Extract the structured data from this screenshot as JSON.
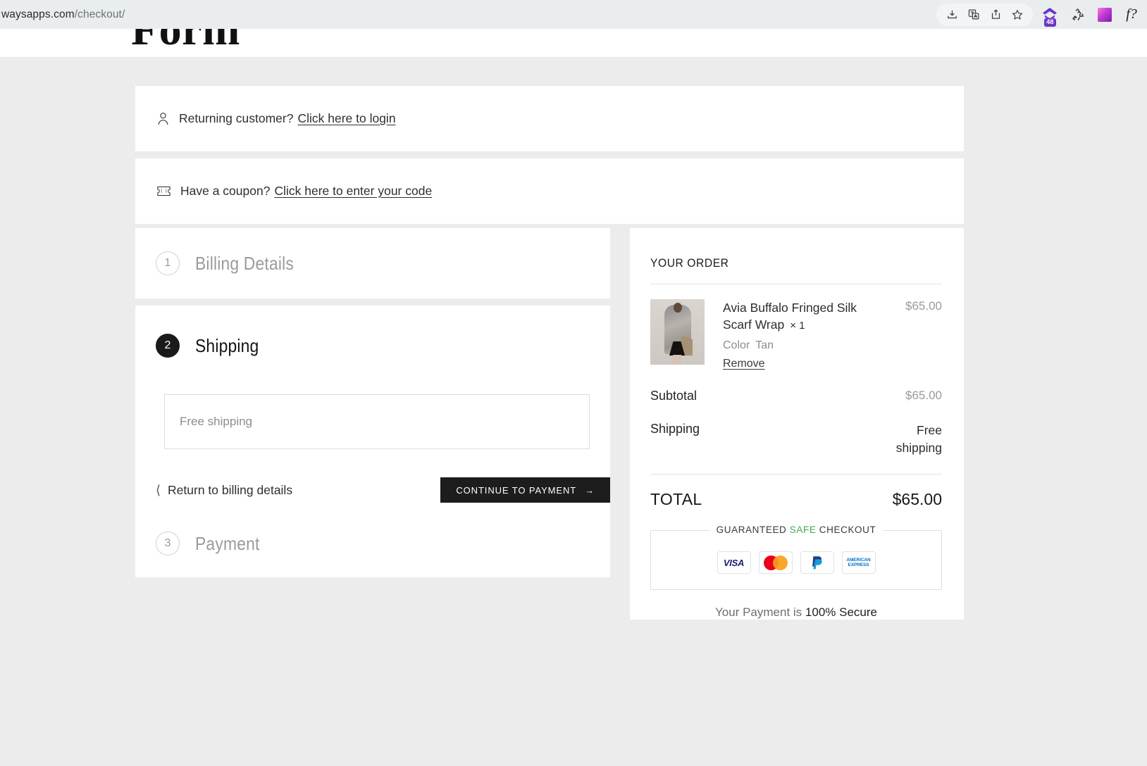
{
  "browser": {
    "url_host": "waysapps.com",
    "url_path": "/checkout/",
    "icons": [
      "download-icon",
      "translate-icon",
      "share-icon",
      "bookmark-star-icon"
    ],
    "extensions": [
      {
        "name": "purple-home-extension-icon",
        "badge": "48"
      },
      {
        "name": "recycle-extension-icon",
        "badge": ""
      },
      {
        "name": "gradient-square-extension-icon",
        "badge": ""
      },
      {
        "name": "font-question-extension-icon",
        "label": "f?"
      }
    ]
  },
  "site": {
    "logo_text": "Form"
  },
  "notices": {
    "login": {
      "icon": "user-icon",
      "text": "Returning customer?",
      "link": "Click here to login"
    },
    "coupon": {
      "icon": "ticket-icon",
      "text": "Have a coupon?",
      "link": "Click here to enter your code"
    }
  },
  "steps": [
    {
      "number": "1",
      "title": "Billing Details",
      "state": "idle"
    },
    {
      "number": "2",
      "title": "Shipping",
      "state": "active"
    },
    {
      "number": "3",
      "title": "Payment",
      "state": "idle"
    }
  ],
  "shipping_section": {
    "option_label": "Free shipping",
    "back_link": "Return to billing details",
    "continue_button": "CONTINUE TO PAYMENT"
  },
  "order": {
    "heading": "YOUR ORDER",
    "item": {
      "name": "Avia Buffalo Fringed Silk Scarf Wrap",
      "quantity": "× 1",
      "attribute_label": "Color",
      "attribute_value": "Tan",
      "remove_label": "Remove",
      "price": "$65.00"
    },
    "subtotal_label": "Subtotal",
    "subtotal_value": "$65.00",
    "shipping_label": "Shipping",
    "shipping_value": "Free shipping",
    "total_label": "TOTAL",
    "total_value": "$65.00",
    "safe_checkout": {
      "prefix": "GUARANTEED ",
      "highlight": "SAFE",
      "suffix": " CHECKOUT",
      "highlight_color": "#3ea954",
      "cards": [
        "VISA",
        "mastercard",
        "PayPal",
        "AMERICAN EXPRESS"
      ]
    },
    "secure_note_prefix": "Your Payment is ",
    "secure_note_strong": "100% Secure"
  }
}
